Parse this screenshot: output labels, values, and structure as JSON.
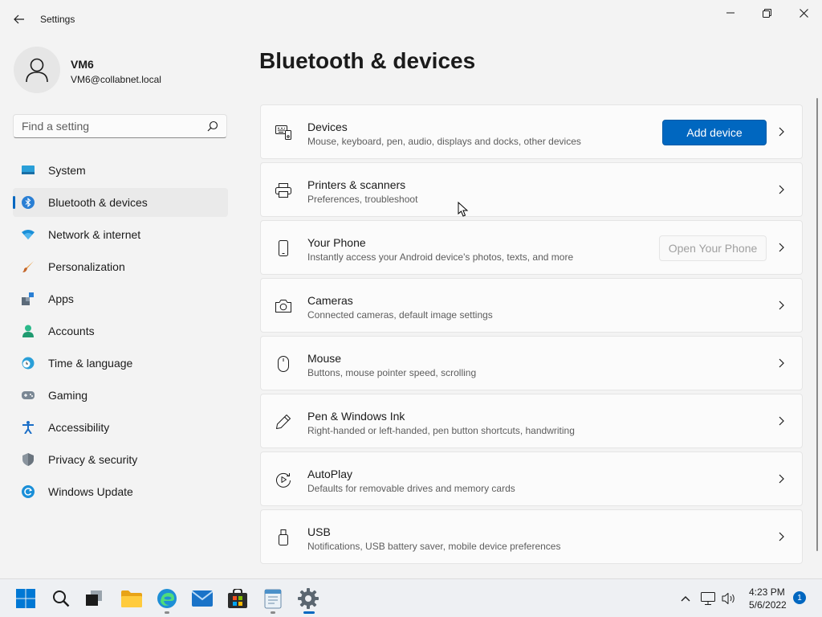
{
  "window": {
    "title": "Settings"
  },
  "profile": {
    "name": "VM6",
    "email": "VM6@collabnet.local"
  },
  "search": {
    "placeholder": "Find a setting",
    "value": ""
  },
  "sidebar": {
    "items": [
      {
        "label": "System",
        "icon": "monitor-icon",
        "selected": false
      },
      {
        "label": "Bluetooth & devices",
        "icon": "bluetooth-icon",
        "selected": true
      },
      {
        "label": "Network & internet",
        "icon": "wifi-icon",
        "selected": false
      },
      {
        "label": "Personalization",
        "icon": "brush-icon",
        "selected": false
      },
      {
        "label": "Apps",
        "icon": "apps-icon",
        "selected": false
      },
      {
        "label": "Accounts",
        "icon": "person-icon",
        "selected": false
      },
      {
        "label": "Time & language",
        "icon": "globe-clock-icon",
        "selected": false
      },
      {
        "label": "Gaming",
        "icon": "gamepad-icon",
        "selected": false
      },
      {
        "label": "Accessibility",
        "icon": "accessibility-icon",
        "selected": false
      },
      {
        "label": "Privacy & security",
        "icon": "shield-icon",
        "selected": false
      },
      {
        "label": "Windows Update",
        "icon": "update-icon",
        "selected": false
      }
    ]
  },
  "main": {
    "title": "Bluetooth & devices",
    "cards": [
      {
        "title": "Devices",
        "subtitle": "Mouse, keyboard, pen, audio, displays and docks, other devices",
        "icon": "devices-icon",
        "button": "Add device"
      },
      {
        "title": "Printers & scanners",
        "subtitle": "Preferences, troubleshoot",
        "icon": "printer-icon"
      },
      {
        "title": "Your Phone",
        "subtitle": "Instantly access your Android device's photos, texts, and more",
        "icon": "phone-icon",
        "button": "Open Your Phone"
      },
      {
        "title": "Cameras",
        "subtitle": "Connected cameras, default image settings",
        "icon": "camera-icon"
      },
      {
        "title": "Mouse",
        "subtitle": "Buttons, mouse pointer speed, scrolling",
        "icon": "mouse-icon"
      },
      {
        "title": "Pen & Windows Ink",
        "subtitle": "Right-handed or left-handed, pen button shortcuts, handwriting",
        "icon": "pen-icon"
      },
      {
        "title": "AutoPlay",
        "subtitle": "Defaults for removable drives and memory cards",
        "icon": "autoplay-icon"
      },
      {
        "title": "USB",
        "subtitle": "Notifications, USB battery saver, mobile device preferences",
        "icon": "usb-icon"
      }
    ]
  },
  "taskbar": {
    "time": "4:23 PM",
    "date": "5/6/2022",
    "notifications": "1",
    "accent": "#0067c0"
  }
}
